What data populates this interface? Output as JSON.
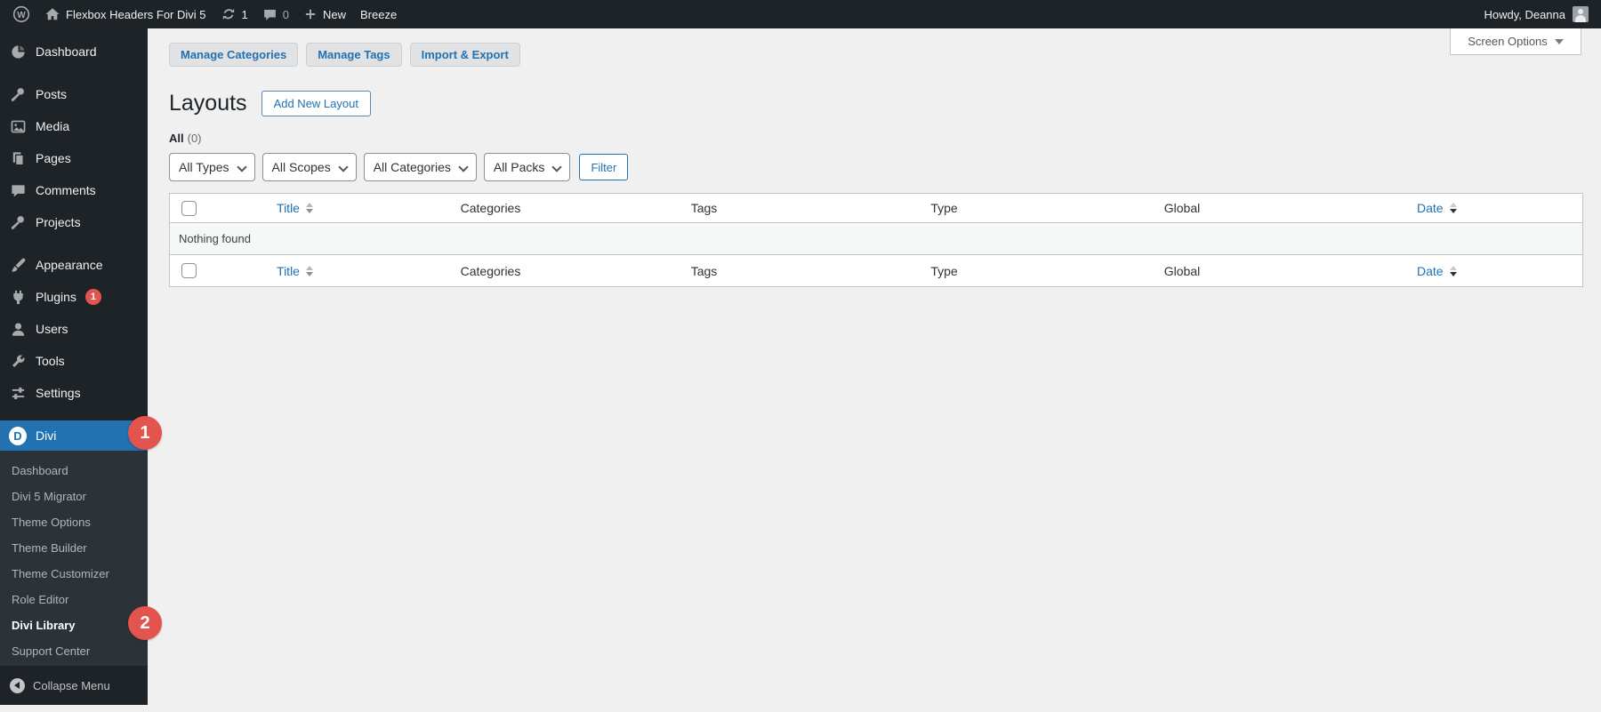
{
  "admin_bar": {
    "site_name": "Flexbox Headers For Divi 5",
    "update_count": "1",
    "comment_count": "0",
    "new_label": "New",
    "breeze_label": "Breeze",
    "howdy": "Howdy, Deanna"
  },
  "screen_options": {
    "label": "Screen Options"
  },
  "sidebar": {
    "items": [
      {
        "label": "Dashboard"
      },
      {
        "label": "Posts"
      },
      {
        "label": "Media"
      },
      {
        "label": "Pages"
      },
      {
        "label": "Comments"
      },
      {
        "label": "Projects"
      },
      {
        "label": "Appearance"
      },
      {
        "label": "Plugins",
        "badge": "1"
      },
      {
        "label": "Users"
      },
      {
        "label": "Tools"
      },
      {
        "label": "Settings"
      },
      {
        "label": "Divi"
      }
    ],
    "divi_submenu": [
      {
        "label": "Dashboard"
      },
      {
        "label": "Divi 5 Migrator"
      },
      {
        "label": "Theme Options"
      },
      {
        "label": "Theme Builder"
      },
      {
        "label": "Theme Customizer"
      },
      {
        "label": "Role Editor"
      },
      {
        "label": "Divi Library"
      },
      {
        "label": "Support Center"
      }
    ],
    "collapse_label": "Collapse Menu"
  },
  "annotations": {
    "step_1": "1",
    "step_2": "2"
  },
  "toolbar": {
    "manage_categories_label": "Manage Categories",
    "manage_tags_label": "Manage Tags",
    "import_export_label": "Import & Export"
  },
  "page": {
    "title": "Layouts",
    "add_new_label": "Add New Layout",
    "views_all_label": "All",
    "views_all_count": "(0)"
  },
  "filters": {
    "types_value": "All Types",
    "scopes_value": "All Scopes",
    "categories_value": "All Categories",
    "packs_value": "All Packs",
    "filter_button_label": "Filter"
  },
  "table": {
    "columns": {
      "title": "Title",
      "categories": "Categories",
      "tags": "Tags",
      "type": "Type",
      "global": "Global",
      "date": "Date"
    },
    "empty_message": "Nothing found"
  },
  "colors": {
    "accent_blue": "#2271b1",
    "badge_red": "#e4544e",
    "admin_bar_bg": "#1d2327",
    "submenu_bg": "#2c3338",
    "page_bg": "#f0f0f1"
  }
}
